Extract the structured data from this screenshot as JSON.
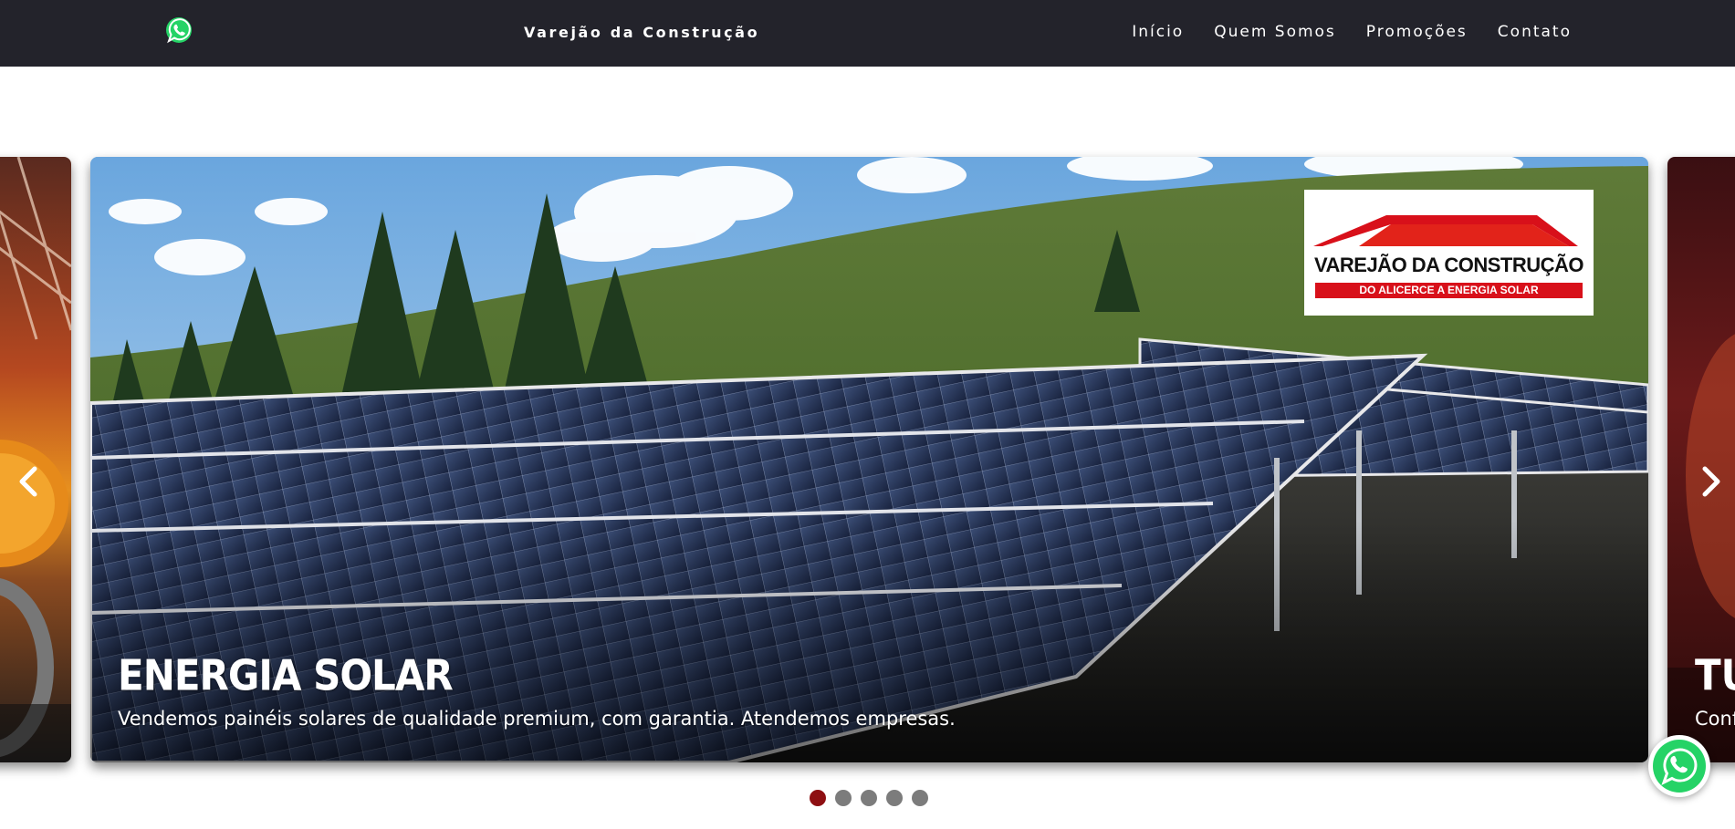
{
  "nav": {
    "brand": "Varejão da Construção",
    "links": [
      "Início",
      "Quem Somos",
      "Promoções",
      "Contato"
    ],
    "whatsapp_icon": "whatsapp-icon"
  },
  "carousel": {
    "active_slide": {
      "title": "ENERGIA SOLAR",
      "text": "Vendemos painéis solares de qualidade premium, com garantia. Atendemos empresas."
    },
    "next_slide": {
      "title": "TU",
      "text": "Conf"
    },
    "logo": {
      "name": "VAREJÃO DA CONSTRUÇÃO",
      "tagline": "DO ALICERCE A ENERGIA SOLAR",
      "roof_color": "#d8101a"
    },
    "dots_count": 5,
    "active_dot": 1,
    "colors": {
      "active_dot": "#8e0f12",
      "inactive_dot": "#7c7c7c",
      "navbar": "#23232b"
    }
  },
  "floating_button": "whatsapp-icon"
}
